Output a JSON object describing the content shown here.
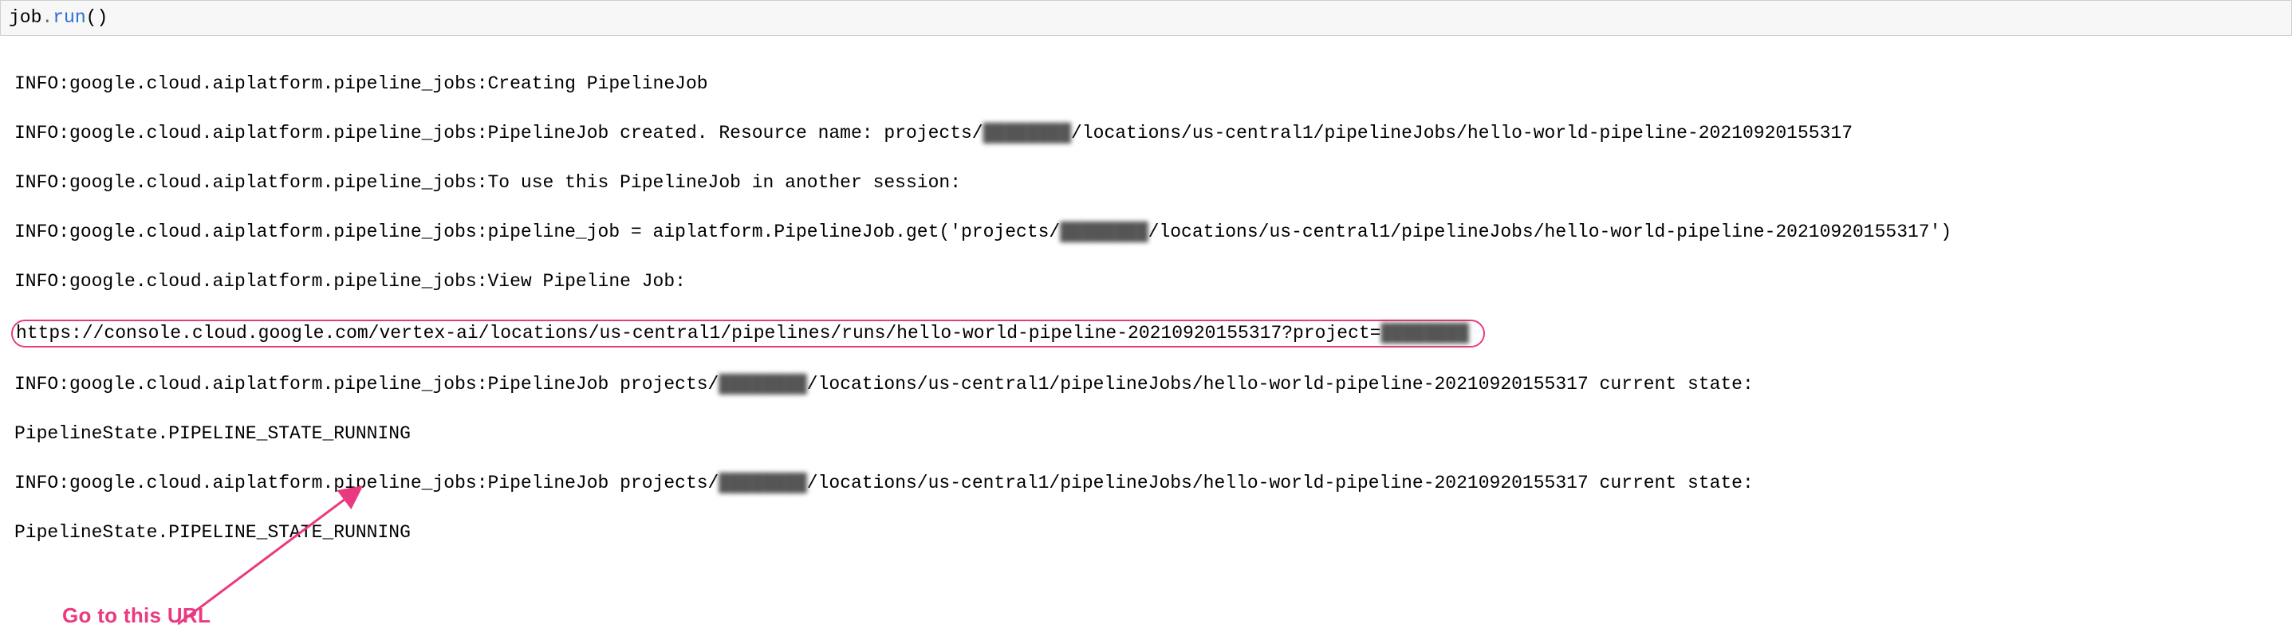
{
  "code": {
    "object": "job",
    "method": "run",
    "parens": "()"
  },
  "log": {
    "prefix": "INFO:google.cloud.aiplatform.pipeline_jobs:",
    "creating": "Creating PipelineJob",
    "created_prefix": "PipelineJob created. Resource name: projects/",
    "redacted_project": "████████",
    "created_suffix": "/locations/us-central1/pipelineJobs/hello-world-pipeline-20210920155317",
    "to_use": "To use this PipelineJob in another session:",
    "pipeline_job_prefix": "pipeline_job = aiplatform.PipelineJob.get('projects/",
    "pipeline_job_suffix": "/locations/us-central1/pipelineJobs/hello-world-pipeline-20210920155317')",
    "view": "View Pipeline Job:",
    "url_prefix": "https://console.cloud.google.com/vertex-ai/locations/us-central1/pipelines/runs/hello-world-pipeline-20210920155317?project=",
    "state_prefix": "PipelineJob projects/",
    "state_mid": "/locations/us-central1/pipelineJobs/hello-world-pipeline-20210920155317 current state:",
    "state_value": "PipelineState.PIPELINE_STATE_RUNNING"
  },
  "annotation": {
    "label": "Go to this URL"
  }
}
